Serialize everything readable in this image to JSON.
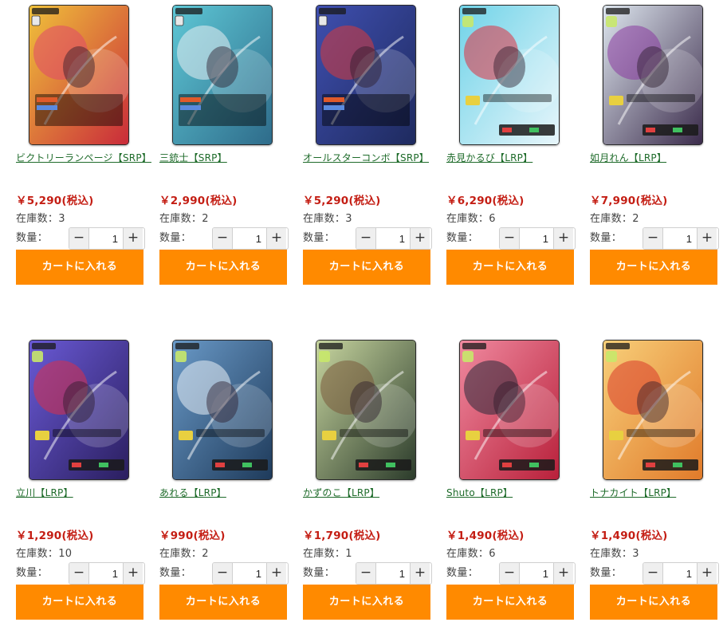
{
  "cart_label": "カートに入れる",
  "qty_label": "数量：",
  "products": [
    {
      "name": "ビクトリーランページ【SRP】",
      "price": "￥5,290(税込)",
      "stock": "在庫数：3",
      "qty": "1",
      "art": {
        "bg1": "#f0c23a",
        "bg2": "#c92a3a",
        "accent": "#e0486a",
        "badge": "ATTACK"
      }
    },
    {
      "name": "三銃士【SRP】",
      "price": "￥2,990(税込)",
      "stock": "在庫数：2",
      "qty": "1",
      "art": {
        "bg1": "#5ec8d6",
        "bg2": "#2e6b8a",
        "accent": "#e8eef2",
        "badge": "ATTACK"
      }
    },
    {
      "name": "オールスターコンボ【SRP】",
      "price": "￥5,290(税込)",
      "stock": "在庫数：3",
      "qty": "1",
      "art": {
        "bg1": "#3f4fb0",
        "bg2": "#1e2a5e",
        "accent": "#d83a3a",
        "badge": "ATTACK"
      }
    },
    {
      "name": "赤見かるび【LRP】",
      "price": "￥6,290(税込)",
      "stock": "在庫数：6",
      "qty": "1",
      "art": {
        "bg1": "#6fd3e8",
        "bg2": "#e8f6fb",
        "accent": "#e03040",
        "badge": "LEADER"
      }
    },
    {
      "name": "如月れん【LRP】",
      "price": "￥7,990(税込)",
      "stock": "在庫数：2",
      "qty": "1",
      "art": {
        "bg1": "#dfe8f0",
        "bg2": "#3a2a4a",
        "accent": "#8a3aa0",
        "badge": "LEADER"
      }
    },
    {
      "name": "立川【LRP】",
      "price": "￥1,290(税込)",
      "stock": "在庫数：10",
      "qty": "1",
      "art": {
        "bg1": "#6a5ad6",
        "bg2": "#2a1e5e",
        "accent": "#d8304a",
        "badge": "LEADER"
      }
    },
    {
      "name": "あれる【LRP】",
      "price": "￥990(税込)",
      "stock": "在庫数：2",
      "qty": "1",
      "art": {
        "bg1": "#6a9ac8",
        "bg2": "#1e3a5a",
        "accent": "#e8eef5",
        "badge": "LEADER"
      }
    },
    {
      "name": "かずのこ【LRP】",
      "price": "￥1,790(税込)",
      "stock": "在庫数：1",
      "qty": "1",
      "art": {
        "bg1": "#c8d6a0",
        "bg2": "#2a3a2a",
        "accent": "#7a5a3a",
        "badge": "LEADER"
      }
    },
    {
      "name": "Shuto【LRP】",
      "price": "￥1,490(税込)",
      "stock": "在庫数：6",
      "qty": "1",
      "art": {
        "bg1": "#f08aa0",
        "bg2": "#b8203a",
        "accent": "#2a2a3a",
        "badge": "LEADER"
      }
    },
    {
      "name": "トナカイト【LRP】",
      "price": "￥1,490(税込)",
      "stock": "在庫数：3",
      "qty": "1",
      "art": {
        "bg1": "#f8d07a",
        "bg2": "#e07a2a",
        "accent": "#d83a2a",
        "badge": "LEADER"
      }
    }
  ]
}
